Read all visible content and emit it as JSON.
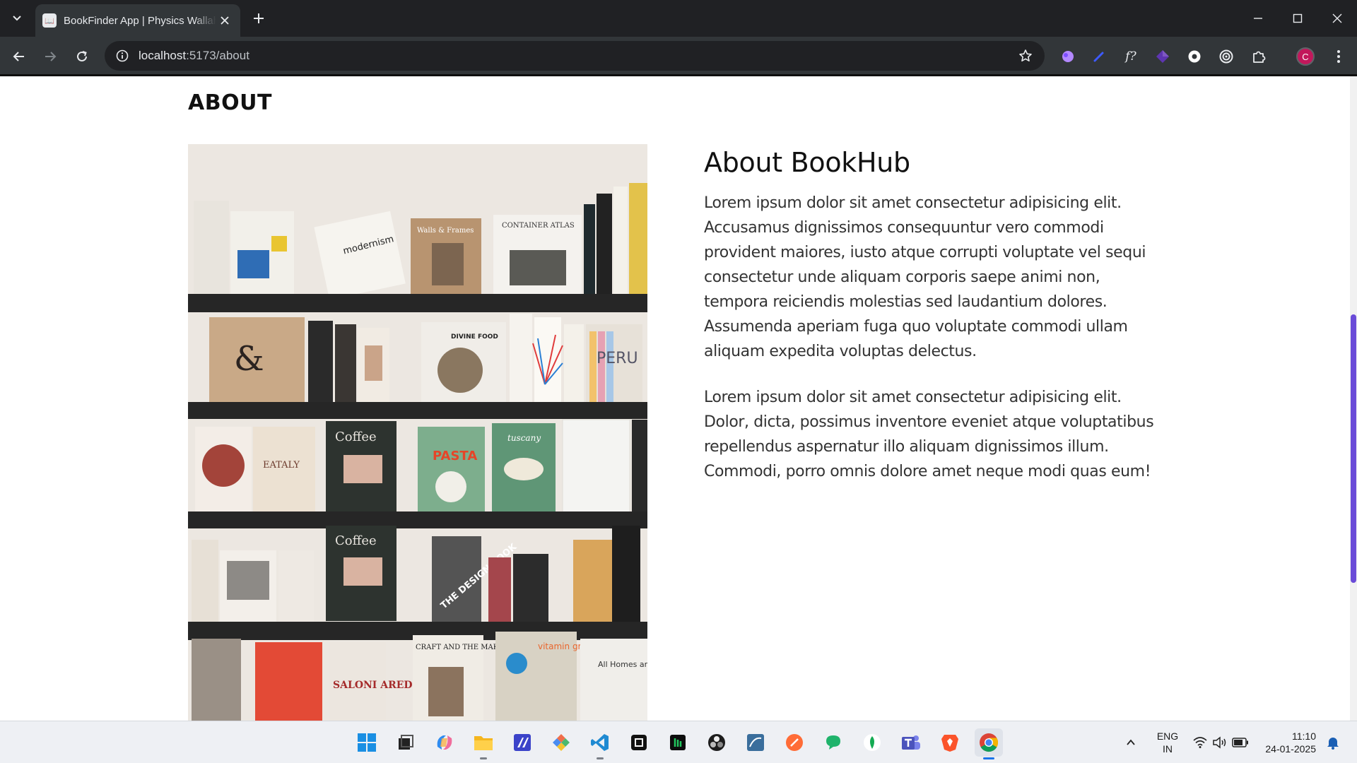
{
  "browser": {
    "tab_title": "BookFinder App | Physics Wallah",
    "url_host": "localhost",
    "url_rest": ":5173/about",
    "profile_initial": "C",
    "extensions": [
      "brush-icon",
      "pen-icon",
      "function-icon",
      "cube-icon",
      "disc-icon",
      "target-icon",
      "puzzle-icon"
    ]
  },
  "page": {
    "heading": "ABOUT",
    "image_alt": "Bookshelves with design and cookbooks",
    "title": "About BookHub",
    "paragraphs": [
      "Lorem ipsum dolor sit amet consectetur adipisicing elit. Accusamus dignissimos consequuntur vero commodi provident maiores, iusto atque corrupti voluptate vel sequi consectetur unde aliquam corporis saepe animi non, tempora reiciendis molestias sed laudantium dolores. Assumenda aperiam fuga quo voluptate commodi ullam aliquam expedita voluptas delectus.",
      "Lorem ipsum dolor sit amet consectetur adipisicing elit. Dolor, dicta, possimus inventore eveniet atque voluptatibus repellendus aspernatur illo aliquam dignissimos illum. Commodi, porro omnis dolore amet neque modi quas eum!"
    ],
    "scroll_fraction": 0.37
  },
  "book_covers": {
    "modernism": "modernism",
    "walls_frames": "Walls & Frames",
    "container_atlas": "CONTAINER ATLAS",
    "divine_food": "DIVINE FOOD",
    "peru": "PERU",
    "coffee": "Coffee",
    "eataly": "EATALY",
    "pasta": "PASTA",
    "tuscany": "tuscany",
    "coffee2": "Coffee",
    "design_book": "THE DESIGN BOOK",
    "craft_makers": "CRAFT AND THE MAKERS",
    "vitamin_green": "vitamin green",
    "homes_living": "All Homes and Living",
    "saloni": "SALONI AREDO OPERA"
  },
  "taskbar": {
    "apps": [
      "windows-start",
      "task-view",
      "copilot",
      "file-explorer",
      "editor",
      "git",
      "vscode",
      "notion",
      "terminal",
      "obs",
      "mysql-workbench",
      "postman",
      "chat",
      "mongodb",
      "teams",
      "brave",
      "chrome"
    ],
    "lang_line1": "ENG",
    "lang_line2": "IN",
    "time": "11:10",
    "date": "24-01-2025"
  },
  "colors": {
    "accent": "#1a73e8",
    "scroll_thumb": "#6a4bd8",
    "profile": "#c2185b"
  }
}
